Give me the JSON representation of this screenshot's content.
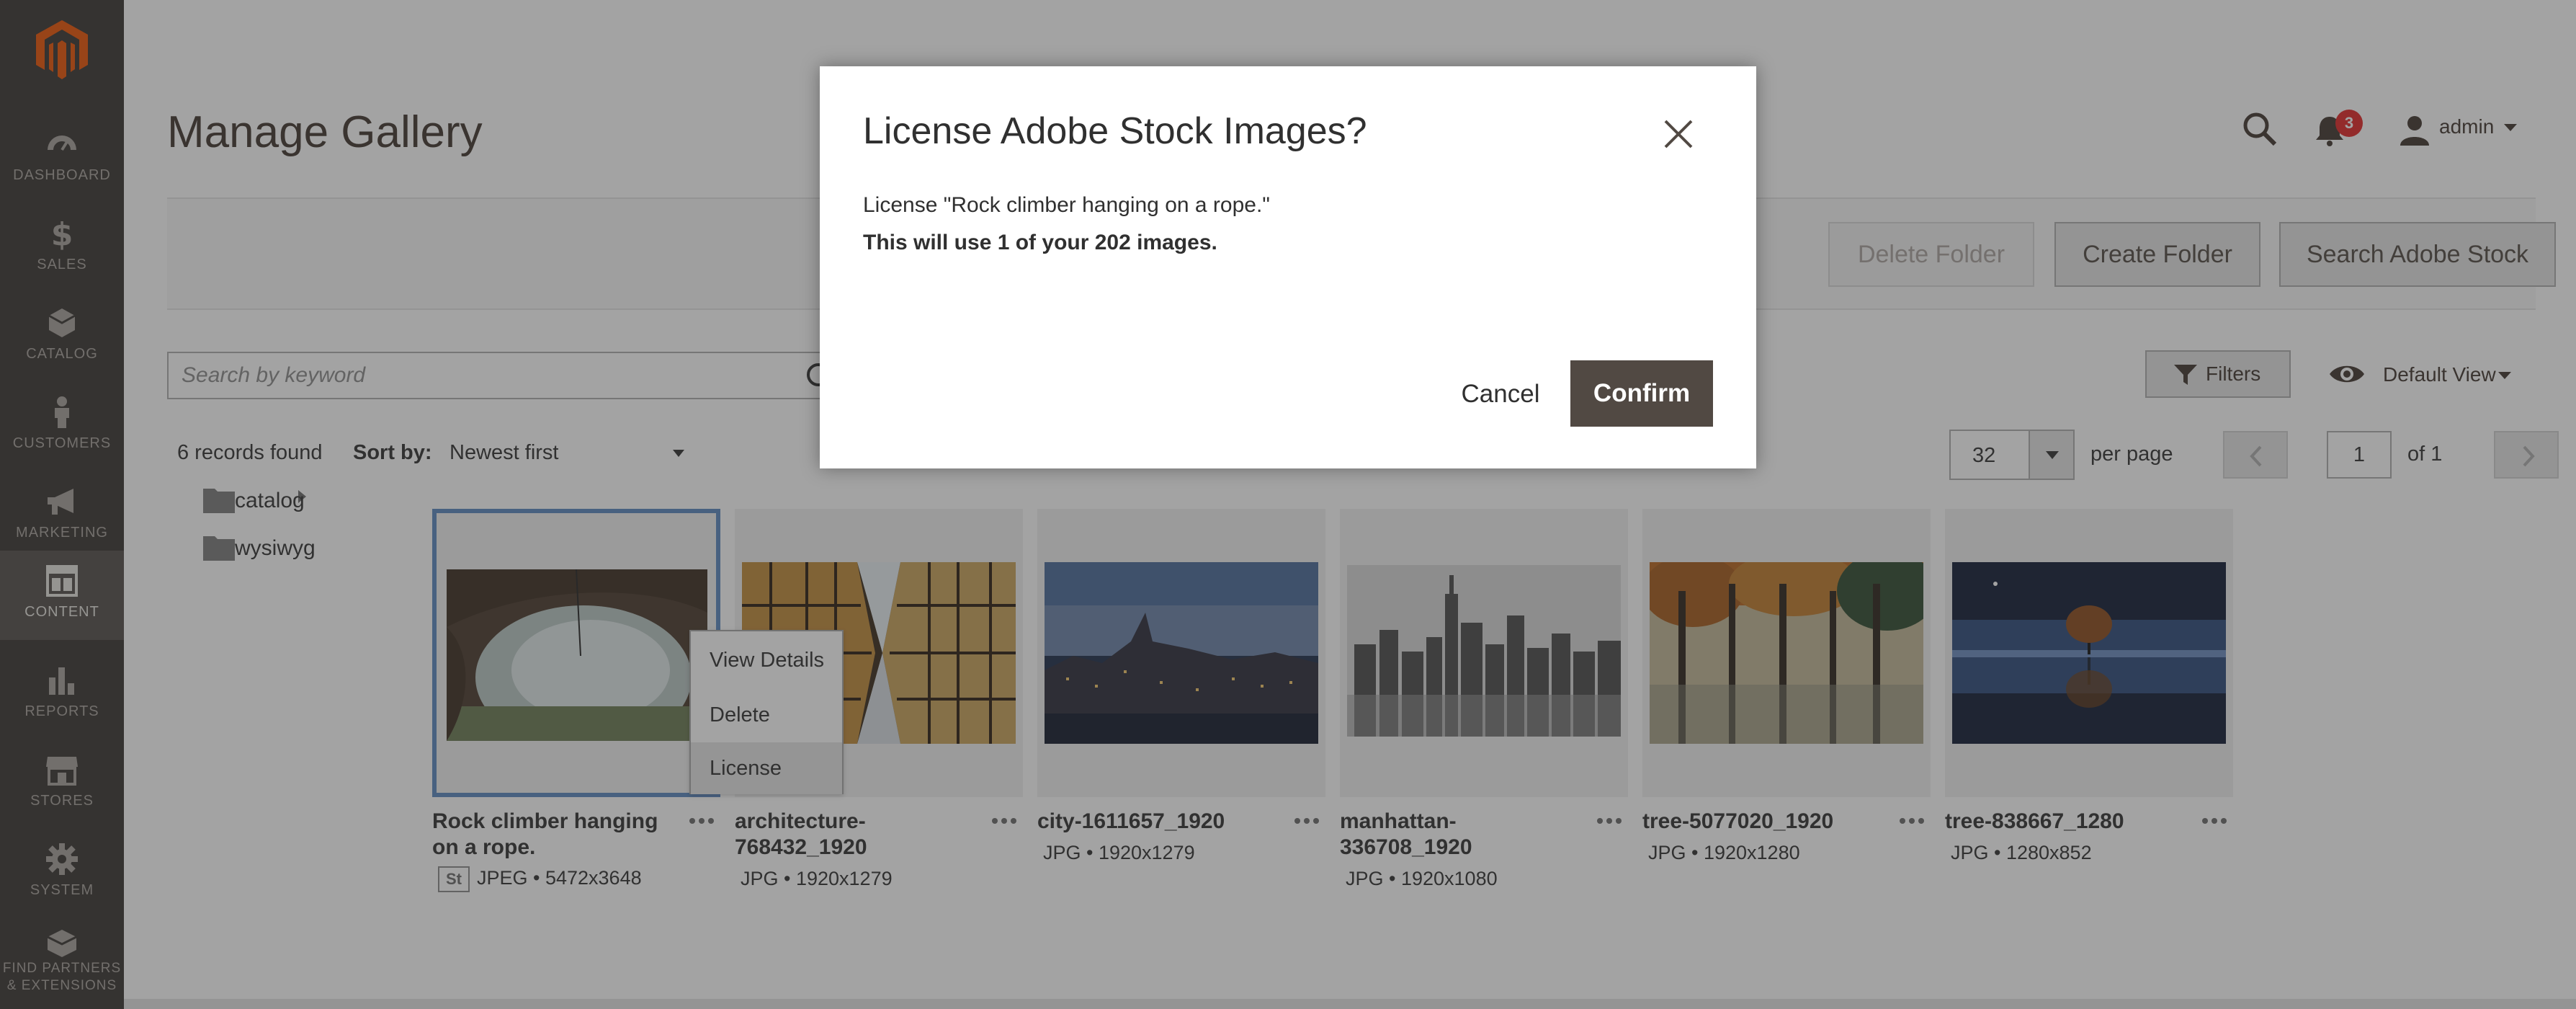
{
  "sidebar": {
    "items": [
      {
        "label": "DASHBOARD",
        "icon": "dashboard-icon"
      },
      {
        "label": "SALES",
        "icon": "dollar-icon"
      },
      {
        "label": "CATALOG",
        "icon": "cube-icon"
      },
      {
        "label": "CUSTOMERS",
        "icon": "person-icon"
      },
      {
        "label": "MARKETING",
        "icon": "megaphone-icon"
      },
      {
        "label": "CONTENT",
        "icon": "layout-icon",
        "active": true
      },
      {
        "label": "REPORTS",
        "icon": "bar-chart-icon"
      },
      {
        "label": "STORES",
        "icon": "storefront-icon"
      },
      {
        "label": "SYSTEM",
        "icon": "gear-icon"
      },
      {
        "label": "FIND PARTNERS",
        "label2": "& EXTENSIONS",
        "icon": "boxes-icon"
      }
    ]
  },
  "header": {
    "title": "Manage Gallery",
    "notifications_count": "3",
    "user": "admin"
  },
  "actions": {
    "delete_folder": "Delete Folder",
    "create_folder": "Create Folder",
    "search_adobe_stock": "Search Adobe Stock"
  },
  "search": {
    "placeholder": "Search by keyword"
  },
  "toolbar": {
    "filters": "Filters",
    "view": "Default View",
    "records_found": "6 records found",
    "sort_label": "Sort by:",
    "sort_value": "Newest first",
    "per_page_value": "32",
    "per_page_label": "per page",
    "current_page": "1",
    "total_pages": "of 1"
  },
  "folders": [
    "catalog",
    "wysiwyg"
  ],
  "images": [
    {
      "title_line1": "Rock climber hanging",
      "title_line2": "on a rope.",
      "badge": "St",
      "meta": "JPEG • 5472x3648"
    },
    {
      "title_line1": "architecture-",
      "title_line2": "768432_1920",
      "meta": "JPG • 1920x1279"
    },
    {
      "title_line1": "city-1611657_1920",
      "title_line2": "",
      "meta": "JPG • 1920x1279"
    },
    {
      "title_line1": "manhattan-",
      "title_line2": "336708_1920",
      "meta": "JPG • 1920x1080"
    },
    {
      "title_line1": "tree-5077020_1920",
      "title_line2": "",
      "meta": "JPG • 1920x1280"
    },
    {
      "title_line1": "tree-838667_1280",
      "title_line2": "",
      "meta": "JPG • 1280x852"
    }
  ],
  "context_menu": [
    "View Details",
    "Delete",
    "License"
  ],
  "modal": {
    "title": "License Adobe Stock Images?",
    "line1": "License \"Rock climber hanging on a rope.\"",
    "line2": "This will use 1 of your 202 images.",
    "cancel": "Cancel",
    "confirm": "Confirm"
  },
  "colors": {
    "sidebar_bg": "#373330",
    "accent": "#eb5202",
    "primary_button": "#514943",
    "selected_border": "#5a88c0",
    "badge": "#e22626"
  }
}
